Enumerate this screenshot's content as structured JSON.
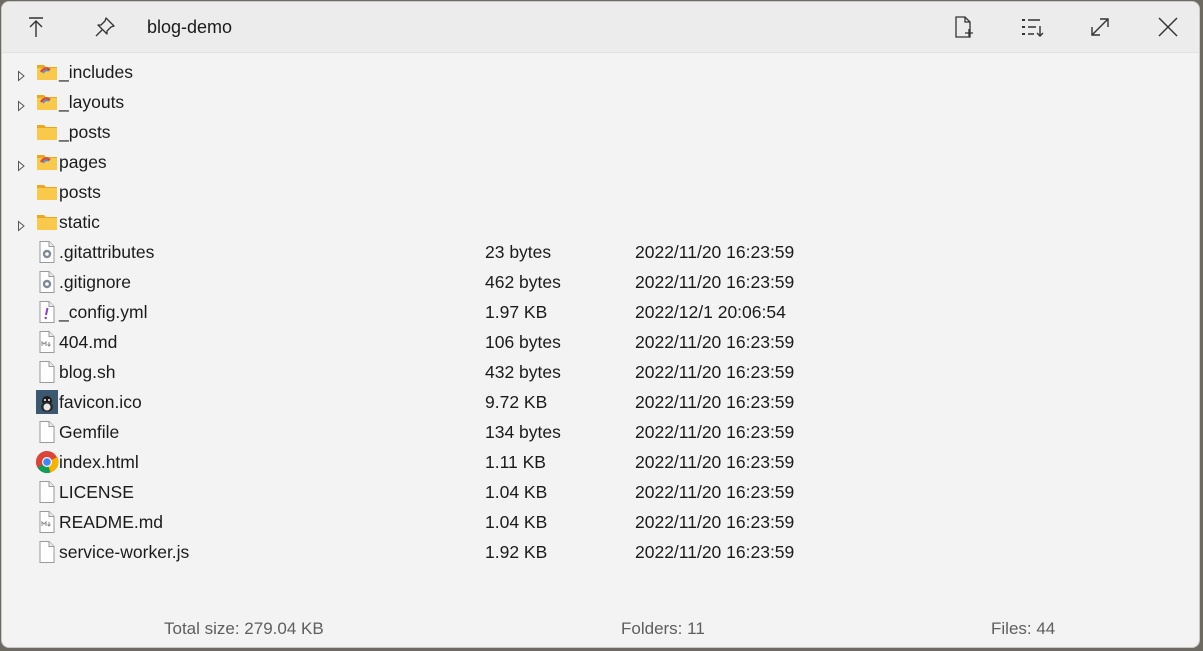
{
  "window": {
    "title": "blog-demo"
  },
  "toolbar": {
    "left_icons": [
      "arrow-up-to-line-icon",
      "pin-icon"
    ],
    "right_icons": [
      "new-file-icon",
      "sort-list-icon",
      "maximize-icon",
      "close-icon"
    ]
  },
  "folders": [
    {
      "name": "_includes",
      "expandable": true,
      "icon": "folder-special-icon"
    },
    {
      "name": "_layouts",
      "expandable": true,
      "icon": "folder-special-icon"
    },
    {
      "name": "_posts",
      "expandable": false,
      "icon": "folder-icon"
    },
    {
      "name": "pages",
      "expandable": true,
      "icon": "folder-special-icon"
    },
    {
      "name": "posts",
      "expandable": false,
      "icon": "folder-icon"
    },
    {
      "name": "static",
      "expandable": true,
      "icon": "folder-icon"
    }
  ],
  "files": [
    {
      "name": ".gitattributes",
      "size": "23 bytes",
      "date": "2022/11/20 16:23:59",
      "icon": "gear-file-icon"
    },
    {
      "name": ".gitignore",
      "size": "462 bytes",
      "date": "2022/11/20 16:23:59",
      "icon": "gear-file-icon"
    },
    {
      "name": "_config.yml",
      "size": "1.97 KB",
      "date": "2022/12/1 20:06:54",
      "icon": "yaml-file-icon"
    },
    {
      "name": "404.md",
      "size": "106 bytes",
      "date": "2022/11/20 16:23:59",
      "icon": "markdown-file-icon"
    },
    {
      "name": "blog.sh",
      "size": "432 bytes",
      "date": "2022/11/20 16:23:59",
      "icon": "blank-file-icon"
    },
    {
      "name": "favicon.ico",
      "size": "9.72 KB",
      "date": "2022/11/20 16:23:59",
      "icon": "favicon-image-icon"
    },
    {
      "name": "Gemfile",
      "size": "134 bytes",
      "date": "2022/11/20 16:23:59",
      "icon": "blank-file-icon"
    },
    {
      "name": "index.html",
      "size": "1.11 KB",
      "date": "2022/11/20 16:23:59",
      "icon": "chrome-icon"
    },
    {
      "name": "LICENSE",
      "size": "1.04 KB",
      "date": "2022/11/20 16:23:59",
      "icon": "blank-file-icon"
    },
    {
      "name": "README.md",
      "size": "1.04 KB",
      "date": "2022/11/20 16:23:59",
      "icon": "markdown-file-icon"
    },
    {
      "name": "service-worker.js",
      "size": "1.92 KB",
      "date": "2022/11/20 16:23:59",
      "icon": "blank-file-icon"
    }
  ],
  "status": {
    "total_size": "Total size: 279.04 KB",
    "folders": "Folders: 11",
    "files": "Files: 44"
  },
  "colors": {
    "folder": "#f8c94a",
    "folder_dark": "#e8a820",
    "window_bg": "#f3f3f3"
  }
}
